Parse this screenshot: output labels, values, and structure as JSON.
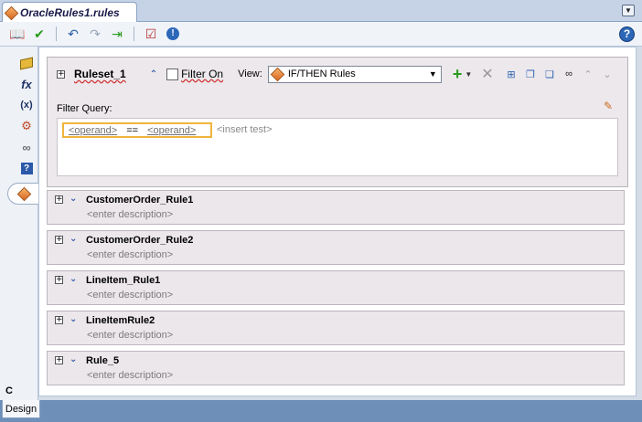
{
  "editor_tab": {
    "label": "OracleRules1.rules"
  },
  "toolbar": {
    "icons": [
      "book-icon",
      "validate-check-icon",
      "undo-icon",
      "redo-icon",
      "export-icon",
      "report-icon",
      "info-icon"
    ]
  },
  "help_label": "?",
  "left_rail": {
    "items": [
      "dictionary-icon",
      "functions-icon",
      "variables-icon",
      "facts-icon",
      "links-icon",
      "help-doc-icon",
      "ruleset-icon"
    ],
    "functions_glyph": "fx",
    "variables_glyph": "(x)",
    "help_glyph": "?",
    "bottom_letter": "C"
  },
  "ruleset": {
    "name": "Ruleset_1",
    "filter_on_label": "Filter On",
    "view_label": "View:",
    "view_value": "IF/THEN Rules",
    "filter_query_label": "Filter Query:",
    "query": {
      "left_operand": "<operand>",
      "operator": "==",
      "right_operand": "<operand>",
      "insert_test": "<insert test>"
    }
  },
  "rules": [
    {
      "name": "CustomerOrder_Rule1",
      "description": "<enter description>"
    },
    {
      "name": "CustomerOrder_Rule2",
      "description": "<enter description>"
    },
    {
      "name": "LineItem_Rule1",
      "description": "<enter description>"
    },
    {
      "name": "LineItemRule2",
      "description": "<enter description>"
    },
    {
      "name": "Rule_5",
      "description": "<enter description>"
    }
  ],
  "bottom_tab": {
    "label": "Design"
  },
  "colors": {
    "accent": "#2c59a8",
    "highlight": "#f0b43c",
    "add_green": "#2a9b1e"
  }
}
